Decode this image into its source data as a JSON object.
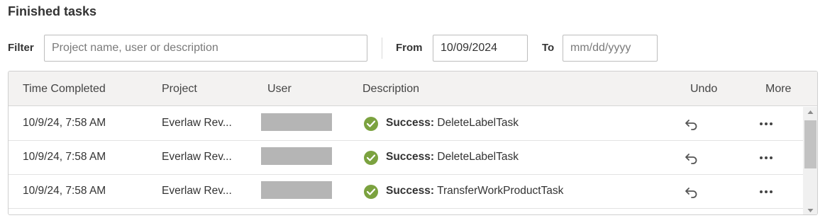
{
  "title": "Finished tasks",
  "filters": {
    "filter_label": "Filter",
    "filter_placeholder": "Project name, user or description",
    "filter_value": "",
    "from_label": "From",
    "from_value": "10/09/2024",
    "to_label": "To",
    "to_placeholder": "mm/dd/yyyy",
    "to_value": ""
  },
  "table": {
    "columns": [
      "Time Completed",
      "Project",
      "User",
      "Description",
      "Undo",
      "More"
    ],
    "rows": [
      {
        "time": "10/9/24, 7:58 AM",
        "project": "Everlaw Rev...",
        "status": "Success:",
        "task": "DeleteLabelTask"
      },
      {
        "time": "10/9/24, 7:58 AM",
        "project": "Everlaw Rev...",
        "status": "Success:",
        "task": "DeleteLabelTask"
      },
      {
        "time": "10/9/24, 7:58 AM",
        "project": "Everlaw Rev...",
        "status": "Success:",
        "task": "TransferWorkProductTask"
      }
    ]
  },
  "icons": {
    "status": "check-circle-icon",
    "undo": "undo-icon",
    "more": "more-horizontal-icon"
  },
  "colors": {
    "success": "#7ba23f",
    "header_bg": "#f3f2f1",
    "redaction": "#b5b5b5"
  }
}
